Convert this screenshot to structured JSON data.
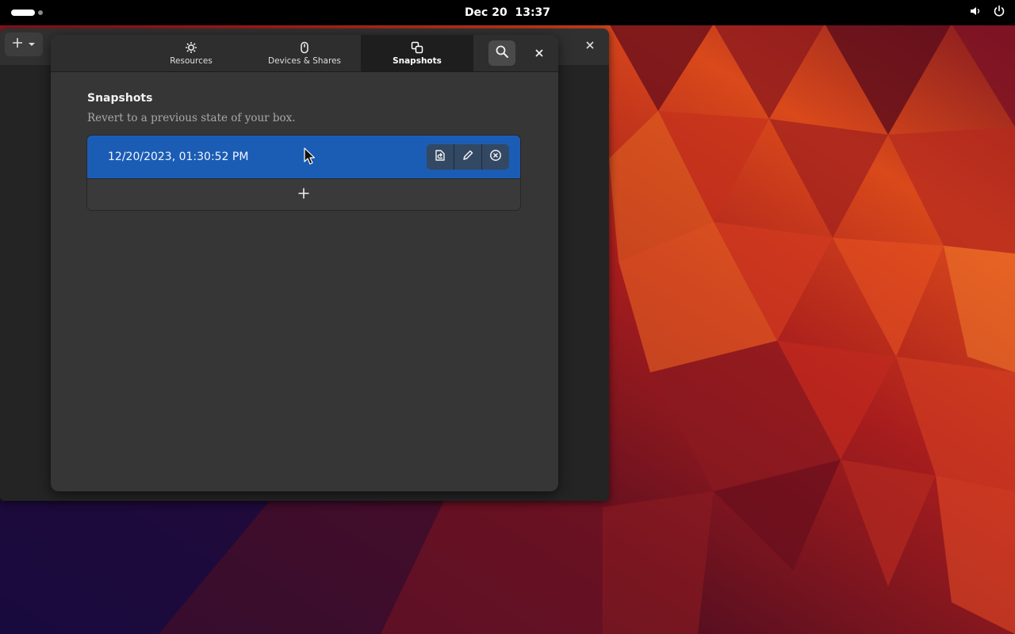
{
  "topbar": {
    "date": "Dec 20",
    "time": "13:37",
    "icons": [
      "activities-indicator",
      "volume-icon",
      "power-icon"
    ]
  },
  "background_window": {
    "new_button_icons": [
      "plus-icon",
      "chevron-down-icon"
    ],
    "close_icon": "close-icon"
  },
  "dialog": {
    "tabs": [
      {
        "label": "Resources",
        "icon": "gear-icon",
        "active": false
      },
      {
        "label": "Devices & Shares",
        "icon": "mouse-icon",
        "active": false
      },
      {
        "label": "Snapshots",
        "icon": "snapshots-icon",
        "active": true
      }
    ],
    "search_icon": "search-icon",
    "close_icon": "close-icon",
    "section": {
      "title": "Snapshots",
      "description": "Revert to a previous state of your box."
    },
    "snapshots": [
      {
        "label": "12/20/2023, 01:30:52 PM",
        "selected": true,
        "actions": [
          "revert-icon",
          "edit-icon",
          "delete-icon"
        ]
      }
    ],
    "add_icon": "plus-icon"
  },
  "colors": {
    "selection": "#1b5db5",
    "dialog_bg": "#363636",
    "header_bg": "#2e2e2e",
    "topbar_bg": "#000000"
  }
}
